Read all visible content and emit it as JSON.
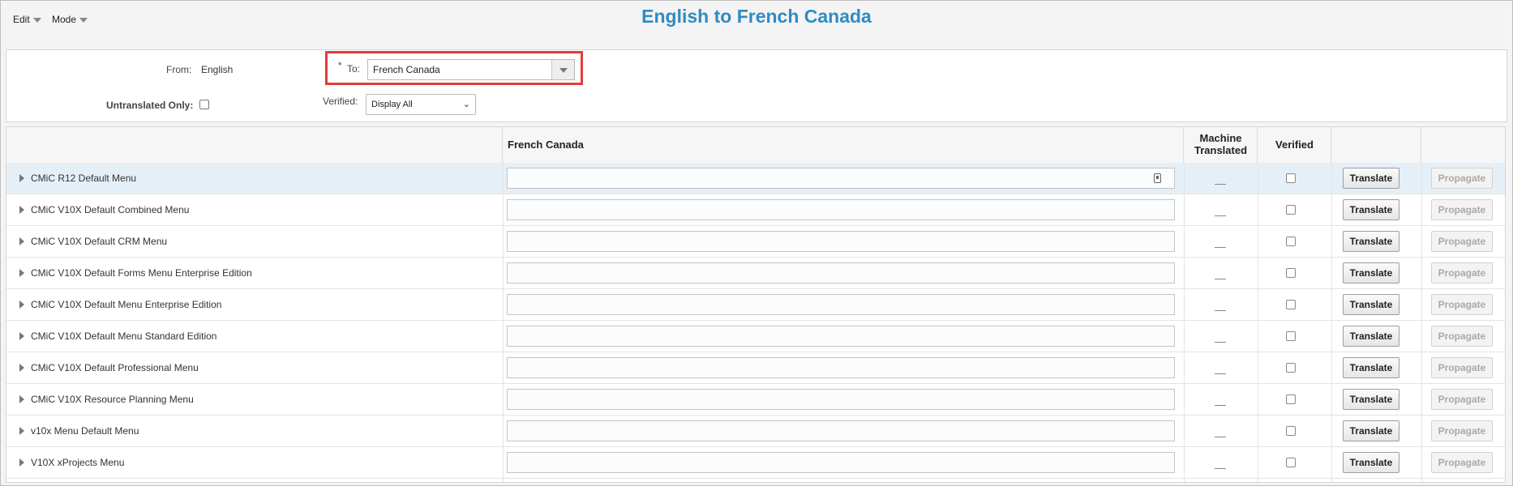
{
  "menubar": {
    "edit_label": "Edit",
    "mode_label": "Mode"
  },
  "page_title": "English to French Canada",
  "filters": {
    "from_label": "From:",
    "from_value": "English",
    "to_required": "*",
    "to_label": "To:",
    "to_value": "French Canada",
    "untranslated_label": "Untranslated Only:",
    "verified_label": "Verified:",
    "verified_value": "Display All"
  },
  "table": {
    "columns": {
      "target_language": "French Canada",
      "machine_translated_line1": "Machine",
      "machine_translated_line2": "Translated",
      "verified": "Verified"
    },
    "rows": [
      {
        "name": "CMiC R12 Default Menu",
        "selected": true
      },
      {
        "name": "CMiC V10X Default Combined Menu"
      },
      {
        "name": "CMiC V10X Default CRM Menu"
      },
      {
        "name": "CMiC V10X Default Forms Menu Enterprise Edition"
      },
      {
        "name": "CMiC V10X Default Menu Enterprise Edition"
      },
      {
        "name": "CMiC V10X Default Menu Standard Edition"
      },
      {
        "name": "CMiC V10X Default Professional Menu"
      },
      {
        "name": "CMiC V10X Resource Planning Menu"
      },
      {
        "name": "v10x Menu Default Menu"
      },
      {
        "name": "V10X xProjects Menu"
      }
    ],
    "translate_label": "Translate",
    "propagate_label": "Propagate"
  },
  "colors": {
    "title": "#2e8cc2",
    "highlight": "#e03c3c",
    "selected_row": "#e5eff8"
  }
}
